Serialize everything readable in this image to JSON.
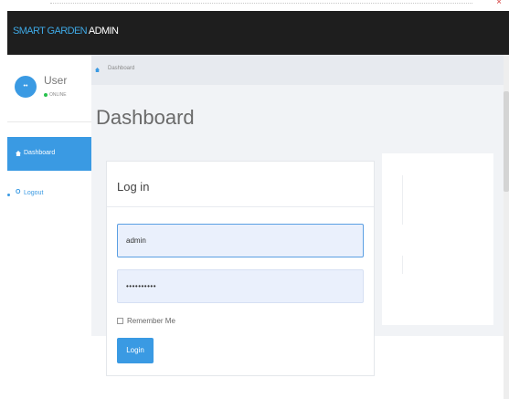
{
  "app": {
    "brand_part1": "SMART GARDEN",
    "brand_part2": "ADMIN",
    "accent_color": "#3a9ae3",
    "topbar_color": "#1e1e1e"
  },
  "sidebar": {
    "user": {
      "avatar_text": "••",
      "name": "User",
      "status": "ONLINE",
      "status_color": "#27c24c"
    },
    "items": [
      {
        "label": "Dashboard",
        "icon": "home-icon",
        "active": true
      },
      {
        "label": "Logout",
        "icon": "power-icon",
        "glyph": "O",
        "active": false
      }
    ]
  },
  "breadcrumb": {
    "icon": "home-icon",
    "label": "Dashboard"
  },
  "page": {
    "title": "Dashboard"
  },
  "login": {
    "title": "Log in",
    "username_value": "admin",
    "password_value": "••••••••••",
    "remember_label": "Remember Me",
    "remember_checked": false,
    "submit_label": "Login"
  },
  "browser": {
    "close_glyph": "×"
  }
}
